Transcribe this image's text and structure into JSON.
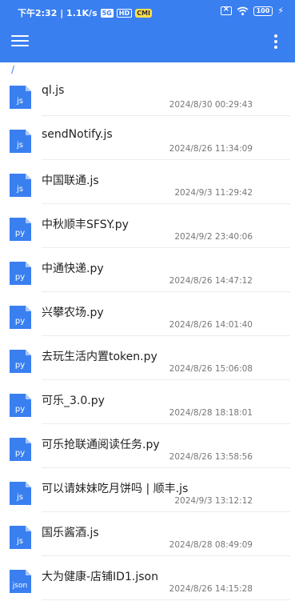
{
  "status_bar": {
    "time_speed": "下午2:32 | 1.1K/s",
    "badge1": "5G",
    "badge2": "HD",
    "badge3": "CMI",
    "battery": "100"
  },
  "breadcrumb": "/",
  "files": [
    {
      "name": "ql.js",
      "date": "2024/8/30 00:29:43",
      "icon": "js"
    },
    {
      "name": "sendNotify.js",
      "date": "2024/8/26 11:34:09",
      "icon": "js"
    },
    {
      "name": "中国联通.js",
      "date": "2024/9/3 11:29:42",
      "icon": "js"
    },
    {
      "name": "中秋顺丰SFSY.py",
      "date": "2024/9/2 23:40:06",
      "icon": "py"
    },
    {
      "name": "中通快递.py",
      "date": "2024/8/26 14:47:12",
      "icon": "py"
    },
    {
      "name": "兴攀农场.py",
      "date": "2024/8/26 14:01:40",
      "icon": "py"
    },
    {
      "name": "去玩生活内置token.py",
      "date": "2024/8/26 15:06:08",
      "icon": "py"
    },
    {
      "name": "可乐_3.0.py",
      "date": "2024/8/28 18:18:01",
      "icon": "py"
    },
    {
      "name": "可乐抢联通阅读任务.py",
      "date": "2024/8/26 13:58:56",
      "icon": "py"
    },
    {
      "name": "可以请妹妹吃月饼吗 | 顺丰.js",
      "date": "2024/9/3 13:12:12",
      "icon": "js"
    },
    {
      "name": "国乐酱酒.js",
      "date": "2024/8/28 08:49:09",
      "icon": "js"
    },
    {
      "name": "大为健康-店铺ID1.json",
      "date": "2024/8/26 14:15:28",
      "icon": "json"
    }
  ]
}
